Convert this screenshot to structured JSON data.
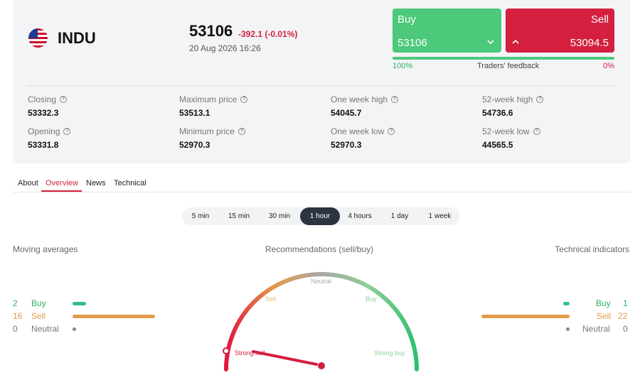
{
  "instrument": {
    "ticker": "INDU",
    "price": "53106",
    "change": "-392.1 (-0.01%)",
    "datetime": "20 Aug 2026 16:26"
  },
  "trade": {
    "buy_label": "Buy",
    "buy_value": "53106",
    "sell_label": "Sell",
    "sell_value": "53094.5",
    "feedback_left": "100%",
    "feedback_label": "Traders' feedback",
    "feedback_right": "0%",
    "buy_share": 1.0
  },
  "stats": [
    {
      "label": "Closing",
      "value": "53332.3"
    },
    {
      "label": "Maximum price",
      "value": "53513.1"
    },
    {
      "label": "One week high",
      "value": "54045.7"
    },
    {
      "label": "52-week high",
      "value": "54736.6"
    },
    {
      "label": "Opening",
      "value": "53331.8"
    },
    {
      "label": "Minimum price",
      "value": "52970.3"
    },
    {
      "label": "One week low",
      "value": "52970.3"
    },
    {
      "label": "52-week low",
      "value": "44565.5"
    }
  ],
  "tabs": [
    "About",
    "Overview",
    "News",
    "Technical"
  ],
  "active_tab": "Overview",
  "periods": [
    "5 min",
    "15 min",
    "30 min",
    "1 hour",
    "4 hours",
    "1 day",
    "1 week"
  ],
  "active_period": "1 hour",
  "moving_averages": {
    "title": "Moving averages",
    "buy": {
      "count": "2",
      "label": "Buy"
    },
    "sell": {
      "count": "16",
      "label": "Sell"
    },
    "neutral": {
      "count": "0",
      "label": "Neutral"
    }
  },
  "gauge": {
    "title": "Recommendations (sell/buy)",
    "labels": {
      "strong_sell": "Strong sell",
      "sell": "Sell",
      "neutral": "Neutral",
      "buy": "Buy",
      "strong_buy": "Strong buy"
    },
    "value": "Strong sell"
  },
  "technical_indicators": {
    "title": "Technical indicators",
    "buy": {
      "count": "1",
      "label": "Buy"
    },
    "sell": {
      "count": "22",
      "label": "Sell"
    },
    "neutral": {
      "count": "0",
      "label": "Neutral"
    }
  },
  "colors": {
    "green": "#4cc97a",
    "red": "#d41f3f",
    "orange": "#e39a4a"
  }
}
